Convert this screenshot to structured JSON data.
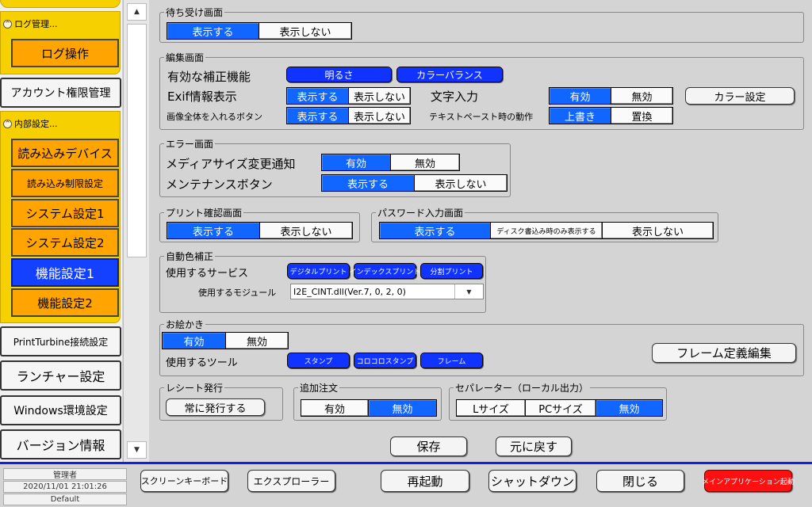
{
  "sidebar": {
    "log_section": "ログ管理...",
    "log_button": "ログ操作",
    "account_button": "アカウント権限管理",
    "internal_section": "内部設定...",
    "internal_items": [
      "読み込みデバイス",
      "読み込み制限設定",
      "システム設定1",
      "システム設定2",
      "機能設定1",
      "機能設定2"
    ],
    "selected": "機能設定1",
    "printturbine": "PrintTurbine接続設定",
    "launcher": "ランチャー設定",
    "windows_env": "Windows環境設定",
    "version": "バージョン情報"
  },
  "standby": {
    "title": "待ち受け画面",
    "options": [
      "表示する",
      "表示しない"
    ],
    "selected": "表示する"
  },
  "edit": {
    "title": "編集画面",
    "correction_label": "有効な補正機能",
    "correction_brightness": "明るさ",
    "correction_color": "カラーバランス",
    "exif_label": "Exif情報表示",
    "exif_options": [
      "表示する",
      "表示しない"
    ],
    "text_input_label": "文字入力",
    "text_input_options": [
      "有効",
      "無効"
    ],
    "color_settings_button": "カラー設定",
    "fit_label": "画像全体を入れるボタン",
    "fit_options": [
      "表示する",
      "表示しない"
    ],
    "paste_label": "テキストペースト時の動作",
    "paste_options": [
      "上書き",
      "置換"
    ]
  },
  "error": {
    "title": "エラー画面",
    "media_label": "メディアサイズ変更通知",
    "media_options": [
      "有効",
      "無効"
    ],
    "maint_label": "メンテナンスボタン",
    "maint_options": [
      "表示する",
      "表示しない"
    ]
  },
  "print_confirm": {
    "title": "プリント確認画面",
    "options": [
      "表示する",
      "表示しない"
    ]
  },
  "password": {
    "title": "パスワード入力画面",
    "options": [
      "表示する",
      "ディスク書込み時のみ表示する",
      "表示しない"
    ]
  },
  "auto_color": {
    "title": "自動色補正",
    "service_label": "使用するサービス",
    "services": [
      "デジタルプリント",
      "インデックスプリント",
      "分割プリント"
    ],
    "module_label": "使用するモジュール",
    "module_value": "I2E_CINT.dll(Ver.7, 0, 2, 0)"
  },
  "drawing": {
    "title": "お絵かき",
    "options": [
      "有効",
      "無効"
    ],
    "tool_label": "使用するツール",
    "tools": [
      "スタンプ",
      "コロコロスタンプ",
      "フレーム"
    ],
    "frame_button": "フレーム定義編集"
  },
  "receipt": {
    "title": "レシート発行",
    "button": "常に発行する"
  },
  "extra_order": {
    "title": "追加注文",
    "options": [
      "有効",
      "無効"
    ]
  },
  "separator": {
    "title": "セパレーター（ローカル出力）",
    "options": [
      "Lサイズ",
      "PCサイズ",
      "無効"
    ]
  },
  "actions": {
    "save": "保存",
    "revert": "元に戻す"
  },
  "footer": {
    "user": "管理者",
    "datetime": "2020/11/01 21:01:26",
    "profile": "Default",
    "screen_keyboard": "スクリーンキーボード",
    "explorer": "エクスプローラー",
    "restart": "再起動",
    "shutdown": "シャットダウン",
    "close": "閉じる",
    "launch_main": "メインアプリケーション起動"
  },
  "colors": {
    "selected_blue": "#1166ff",
    "sidebar_orange": "#ffa400",
    "sidebar_yellow": "#f7d000",
    "danger_red": "#ff1010"
  }
}
